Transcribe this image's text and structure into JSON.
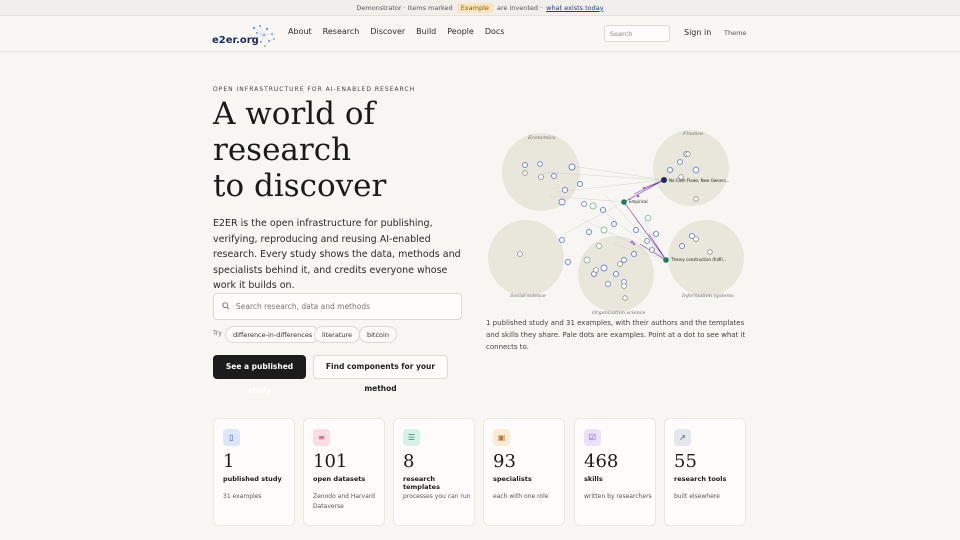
{
  "banner": {
    "lead": "Demonstrator · Items marked",
    "pill": "Example",
    "tail": "are invented ·",
    "link": "what exists today"
  },
  "nav": {
    "logo": "e2er.org",
    "items": [
      "About",
      "Research",
      "Discover",
      "Build",
      "People",
      "Docs"
    ],
    "search_placeholder": "Search",
    "signin": "Sign in",
    "theme": "Theme"
  },
  "hero": {
    "eyebrow": "OPEN INFRASTRUCTURE FOR AI-ENABLED RESEARCH",
    "headline_1": "A world of",
    "headline_2": "research",
    "headline_3": "to discover",
    "lead": "E2ER is the open infrastructure for publishing, verifying, reproducing and reusing AI-enabled research. Every study shows the data, methods and specialists behind it, and credits everyone whose work it builds on.",
    "search_placeholder": "Search research, data and methods",
    "try_label": "Try",
    "chips": [
      "difference-in-differences",
      "literature",
      "bitcoin"
    ],
    "primary_button": "See a published study",
    "secondary_button": "Find components for your method"
  },
  "graph": {
    "clusters": [
      "Economics",
      "Finance",
      "Social science",
      "Organization science",
      "Information systems"
    ],
    "node_labels": [
      "No Cash Flows, New Owners...",
      "Empirical",
      "Theory construction (fulfil..."
    ],
    "caption": "1 published study and 31 examples, with their authors and the templates and skills they share. Pale dots are examples. Point at a dot to see what it connects to."
  },
  "stats": [
    {
      "icon": "document-icon",
      "number": "1",
      "label": "published study",
      "sub": "31 examples",
      "color": "#dde5fb",
      "ink": "#3b55b8"
    },
    {
      "icon": "database-icon",
      "number": "101",
      "label": "open datasets",
      "sub": "Zenodo and Harvard Dataverse",
      "color": "#fbdde6",
      "ink": "#b83b63"
    },
    {
      "icon": "list-icon",
      "number": "8",
      "label": "research templates",
      "sub": "processes you can run",
      "color": "#d8f2ea",
      "ink": "#2a8a6a"
    },
    {
      "icon": "briefcase-icon",
      "number": "93",
      "label": "specialists",
      "sub": "each with one role",
      "color": "#fbead6",
      "ink": "#b8752a"
    },
    {
      "icon": "skill-icon",
      "number": "468",
      "label": "skills",
      "sub": "written by researchers",
      "color": "#ece0fb",
      "ink": "#7a3bb8"
    },
    {
      "icon": "tool-icon",
      "number": "55",
      "label": "research tools",
      "sub": "built elsewhere",
      "color": "#e4e8ee",
      "ink": "#4a5566"
    }
  ]
}
